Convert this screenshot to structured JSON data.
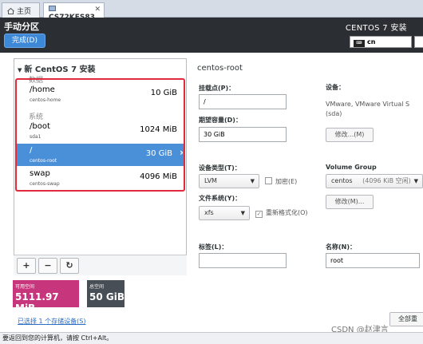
{
  "tabs": [
    {
      "label": "主页"
    },
    {
      "label": "CS72KES83"
    }
  ],
  "header": {
    "title": "手动分区",
    "done_label": "完成(D)",
    "product": "CENTOS 7 安装",
    "keyboard": "cn",
    "keyboard_icon_text": "⌨"
  },
  "install": {
    "title": "新 CentOS 7 安装",
    "section_data": "数据",
    "section_system": "系统",
    "partitions": [
      {
        "name": "/home",
        "device": "centos-home",
        "size": "10 GiB",
        "selected": false
      },
      {
        "name": "/boot",
        "device": "sda1",
        "size": "1024 MiB",
        "selected": false
      },
      {
        "name": "/",
        "device": "centos-root",
        "size": "30 GiB",
        "selected": true
      },
      {
        "name": "swap",
        "device": "centos-swap",
        "size": "4096 MiB",
        "selected": false
      }
    ]
  },
  "toolbar": {
    "add": "+",
    "remove": "−",
    "refresh": "↻"
  },
  "space": {
    "available_label": "可用空间",
    "available_value": "5111.97 MiB",
    "total_label": "总空间",
    "total_value": "50 GiB"
  },
  "selected_devices_link": "已选择 1 个存储设备(S)",
  "details": {
    "title": "centos-root",
    "mount_label": "挂载点(P)：",
    "mount_value": "/",
    "capacity_label": "期望容量(D)：",
    "capacity_value": "30 GiB",
    "device_label": "设备：",
    "device_value_1": "VMware, VMware Virtual S",
    "device_value_2": "(sda)",
    "modify1": "修改...(M)",
    "type_label": "设备类型(T)：",
    "type_value": "LVM",
    "encrypt_label": "加密(E)",
    "fs_label": "文件系统(Y)：",
    "fs_value": "xfs",
    "reformat_label": "重新格式化(O)",
    "vg_label": "Volume Group",
    "vg_value": "centos",
    "vg_free": "(4096 KiB 空闲)",
    "modify2": "修改(M)...",
    "tag_label": "标签(L)：",
    "tag_value": "",
    "name_label": "名称(N)：",
    "name_value": "root",
    "reset_label": "全部重"
  },
  "status": "要返回到您的计算机，请按 Ctrl+Alt。",
  "watermark": "CSDN @赵津言",
  "colors": {
    "header_bg": "#2b2f33",
    "selected": "#4a90d9",
    "available": "#c7367c",
    "total": "#474e55",
    "highlight_border": "#e12a3c",
    "link": "#2a6dc5"
  }
}
